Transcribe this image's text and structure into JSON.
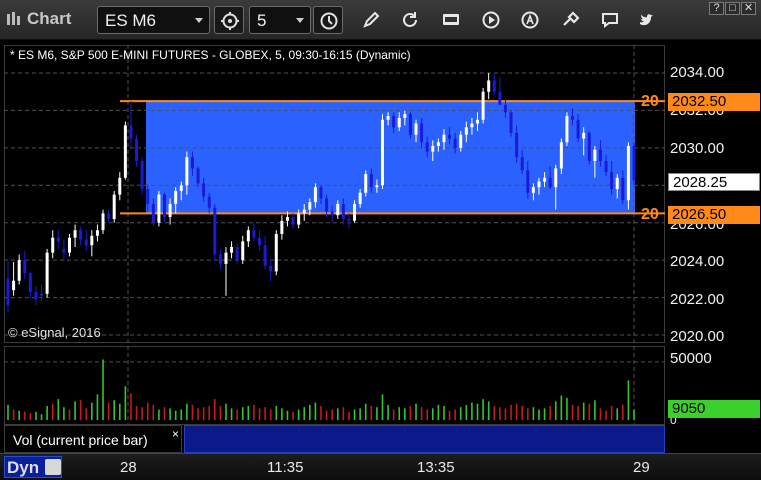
{
  "window": {
    "title": "Chart"
  },
  "toolbar": {
    "symbol_value": "ES M6",
    "interval_value": "5",
    "icons": [
      "chart-window-icon",
      "link-icon",
      "clock-icon",
      "draw-icon",
      "refresh-icon",
      "get-icon",
      "play-icon",
      "alert-icon",
      "tools-icon",
      "chat-icon",
      "twitter-icon"
    ],
    "window_buttons": [
      "?",
      "□",
      "✕"
    ]
  },
  "chart": {
    "description": "* ES M6, S&P 500 E-MINI FUTURES - GLOBEX, 5, 09:30-16:15 (Dynamic)",
    "copyright": "© eSignal, 2016",
    "colors": {
      "up": "#ffffff",
      "down": "#1a1ad8",
      "range_fill": "#2b62ff",
      "range_line": "#ff8a1a",
      "grid": "#3a3a3a",
      "volume_up": "#2fc92f",
      "volume_down": "#c81a1a"
    },
    "price_ticks": [
      "2034.00",
      "2032.00",
      "2030.00",
      "2028.00",
      "2026.00",
      "2024.00",
      "2022.00",
      "2020.00"
    ],
    "range_top": {
      "value": "2032.50",
      "label": "20"
    },
    "range_bottom": {
      "value": "2026.50",
      "label": "20"
    },
    "last_price": "2028.25",
    "volume": {
      "tick": "50000",
      "zero_tick": "0",
      "last": "9050",
      "label": "Vol (current price bar)",
      "close": "×"
    },
    "time_axis": {
      "mode": "Dyn",
      "labels": [
        "28",
        "11:35",
        "13:35",
        "29"
      ]
    }
  },
  "chart_data": {
    "type": "candlestick",
    "title": "ES M6, S&P 500 E-MINI FUTURES - GLOBEX, 5, 09:30-16:15 (Dynamic)",
    "ylim": [
      2020,
      2035
    ],
    "y_ticks": [
      2020,
      2022,
      2024,
      2026,
      2028,
      2030,
      2032,
      2034
    ],
    "x_tick_labels": [
      "28",
      "11:35",
      "13:35",
      "29"
    ],
    "price_zone": {
      "top": 2032.5,
      "bottom": 2026.5
    },
    "last_price": 2028.25,
    "volume_last": 9050,
    "volume_ylim": [
      0,
      55000
    ],
    "candles": [
      [
        2023.0,
        2023.9,
        2021.2,
        2021.6
      ],
      [
        2022.4,
        2023.9,
        2022.1,
        2022.9
      ],
      [
        2022.9,
        2024.3,
        2022.7,
        2024.0
      ],
      [
        2024.0,
        2024.5,
        2023.0,
        2023.3
      ],
      [
        2023.3,
        2023.4,
        2022.0,
        2022.3
      ],
      [
        2022.3,
        2022.6,
        2021.6,
        2021.9
      ],
      [
        2022.2,
        2022.7,
        2021.8,
        2022.1
      ],
      [
        2022.2,
        2024.6,
        2022.0,
        2024.4
      ],
      [
        2024.4,
        2025.6,
        2024.1,
        2025.2
      ],
      [
        2025.2,
        2025.6,
        2024.6,
        2025.0
      ],
      [
        2024.6,
        2025.1,
        2024.0,
        2024.4
      ],
      [
        2024.4,
        2025.4,
        2024.2,
        2025.2
      ],
      [
        2025.2,
        2025.9,
        2024.7,
        2025.6
      ],
      [
        2025.6,
        2025.8,
        2024.8,
        2025.1
      ],
      [
        2025.1,
        2025.6,
        2024.5,
        2024.8
      ],
      [
        2024.8,
        2025.6,
        2024.2,
        2025.3
      ],
      [
        2025.3,
        2025.9,
        2025.0,
        2025.6
      ],
      [
        2025.6,
        2026.7,
        2025.4,
        2026.5
      ],
      [
        2026.5,
        2026.7,
        2026.0,
        2026.2
      ],
      [
        2026.2,
        2027.7,
        2026.0,
        2027.5
      ],
      [
        2027.5,
        2028.7,
        2027.2,
        2028.4
      ],
      [
        2028.4,
        2031.4,
        2028.3,
        2031.2
      ],
      [
        2031.2,
        2032.5,
        2030.0,
        2030.5
      ],
      [
        2030.5,
        2030.7,
        2029.0,
        2029.3
      ],
      [
        2029.3,
        2029.5,
        2027.5,
        2027.8
      ],
      [
        2027.8,
        2028.0,
        2026.6,
        2027.0
      ],
      [
        2027.0,
        2027.3,
        2025.8,
        2026.0
      ],
      [
        2026.0,
        2027.7,
        2025.8,
        2027.5
      ],
      [
        2027.5,
        2027.6,
        2026.0,
        2026.3
      ],
      [
        2026.3,
        2027.3,
        2025.9,
        2027.0
      ],
      [
        2027.0,
        2027.9,
        2026.5,
        2027.7
      ],
      [
        2027.7,
        2028.2,
        2027.2,
        2028.0
      ],
      [
        2028.0,
        2029.8,
        2027.5,
        2029.5
      ],
      [
        2029.5,
        2029.8,
        2028.5,
        2028.9
      ],
      [
        2028.9,
        2029.0,
        2027.9,
        2028.1
      ],
      [
        2028.1,
        2028.4,
        2027.1,
        2027.4
      ],
      [
        2027.4,
        2027.6,
        2026.5,
        2026.8
      ],
      [
        2026.8,
        2027.0,
        2024.0,
        2024.3
      ],
      [
        2024.3,
        2024.6,
        2023.5,
        2023.8
      ],
      [
        2023.8,
        2024.7,
        2022.1,
        2024.4
      ],
      [
        2024.4,
        2025.0,
        2024.1,
        2024.7
      ],
      [
        2024.7,
        2024.9,
        2023.8,
        2024.0
      ],
      [
        2024.0,
        2025.3,
        2023.8,
        2025.0
      ],
      [
        2025.0,
        2025.8,
        2024.7,
        2025.6
      ],
      [
        2025.6,
        2026.0,
        2025.0,
        2025.2
      ],
      [
        2025.2,
        2025.6,
        2024.5,
        2024.8
      ],
      [
        2024.8,
        2025.3,
        2023.5,
        2023.7
      ],
      [
        2023.7,
        2024.0,
        2022.9,
        2023.4
      ],
      [
        2023.4,
        2025.6,
        2023.2,
        2025.4
      ],
      [
        2025.4,
        2026.4,
        2025.1,
        2026.1
      ],
      [
        2026.1,
        2026.6,
        2025.8,
        2026.3
      ],
      [
        2026.3,
        2026.5,
        2025.7,
        2025.9
      ],
      [
        2025.9,
        2026.7,
        2025.7,
        2026.5
      ],
      [
        2026.5,
        2027.0,
        2026.1,
        2026.7
      ],
      [
        2026.7,
        2027.3,
        2026.4,
        2027.1
      ],
      [
        2027.1,
        2028.1,
        2026.8,
        2027.9
      ],
      [
        2027.9,
        2028.0,
        2027.0,
        2027.3
      ],
      [
        2027.3,
        2027.5,
        2026.3,
        2026.6
      ],
      [
        2026.6,
        2026.9,
        2026.0,
        2026.4
      ],
      [
        2026.4,
        2027.2,
        2026.2,
        2027.0
      ],
      [
        2027.0,
        2027.3,
        2025.9,
        2026.2
      ],
      [
        2026.2,
        2026.5,
        2025.7,
        2026.1
      ],
      [
        2026.1,
        2027.2,
        2026.0,
        2027.0
      ],
      [
        2027.0,
        2027.8,
        2026.8,
        2027.6
      ],
      [
        2027.6,
        2028.8,
        2027.4,
        2028.6
      ],
      [
        2028.6,
        2028.9,
        2027.6,
        2027.9
      ],
      [
        2027.9,
        2028.3,
        2027.6,
        2028.0
      ],
      [
        2028.0,
        2031.8,
        2027.8,
        2031.5
      ],
      [
        2031.5,
        2031.9,
        2031.2,
        2031.7
      ],
      [
        2031.7,
        2031.9,
        2030.8,
        2031.1
      ],
      [
        2031.1,
        2031.9,
        2030.9,
        2031.6
      ],
      [
        2031.6,
        2032.0,
        2031.2,
        2031.8
      ],
      [
        2031.8,
        2031.9,
        2030.5,
        2030.7
      ],
      [
        2030.7,
        2031.5,
        2030.3,
        2031.3
      ],
      [
        2031.3,
        2031.6,
        2030.0,
        2030.3
      ],
      [
        2030.3,
        2030.6,
        2029.5,
        2029.8
      ],
      [
        2029.8,
        2030.4,
        2029.3,
        2030.1
      ],
      [
        2030.1,
        2030.5,
        2029.8,
        2030.3
      ],
      [
        2030.3,
        2031.0,
        2029.9,
        2030.7
      ],
      [
        2030.7,
        2031.1,
        2030.2,
        2030.5
      ],
      [
        2030.5,
        2030.8,
        2029.7,
        2030.0
      ],
      [
        2030.0,
        2030.9,
        2029.8,
        2030.7
      ],
      [
        2030.7,
        2031.4,
        2030.3,
        2031.1
      ],
      [
        2031.1,
        2031.6,
        2030.7,
        2031.3
      ],
      [
        2031.3,
        2031.9,
        2030.9,
        2031.5
      ],
      [
        2031.5,
        2033.2,
        2031.3,
        2033.0
      ],
      [
        2033.0,
        2034.0,
        2032.6,
        2033.6
      ],
      [
        2033.6,
        2034.0,
        2032.8,
        2033.0
      ],
      [
        2033.0,
        2033.8,
        2032.6,
        2032.3
      ],
      [
        2032.3,
        2032.6,
        2031.6,
        2031.9
      ],
      [
        2031.9,
        2032.0,
        2030.6,
        2030.8
      ],
      [
        2030.8,
        2031.2,
        2029.2,
        2029.5
      ],
      [
        2029.5,
        2029.9,
        2028.6,
        2028.8
      ],
      [
        2028.8,
        2029.3,
        2027.3,
        2027.6
      ],
      [
        2027.6,
        2028.1,
        2027.2,
        2027.9
      ],
      [
        2027.9,
        2028.4,
        2027.5,
        2028.2
      ],
      [
        2028.2,
        2028.7,
        2027.9,
        2028.4
      ],
      [
        2028.4,
        2029.0,
        2027.8,
        2027.9
      ],
      [
        2027.9,
        2029.1,
        2026.7,
        2028.9
      ],
      [
        2028.9,
        2030.5,
        2028.6,
        2030.3
      ],
      [
        2030.3,
        2031.9,
        2030.1,
        2031.7
      ],
      [
        2031.7,
        2032.1,
        2031.2,
        2031.5
      ],
      [
        2031.5,
        2031.8,
        2030.3,
        2030.5
      ],
      [
        2030.5,
        2031.1,
        2029.6,
        2030.8
      ],
      [
        2030.8,
        2030.9,
        2029.1,
        2029.3
      ],
      [
        2029.3,
        2030.1,
        2028.4,
        2029.9
      ],
      [
        2029.9,
        2030.4,
        2029.0,
        2029.3
      ],
      [
        2029.3,
        2029.6,
        2028.5,
        2028.7
      ],
      [
        2028.7,
        2029.3,
        2027.5,
        2027.8
      ],
      [
        2027.8,
        2028.6,
        2027.3,
        2028.4
      ],
      [
        2028.4,
        2028.8,
        2027.0,
        2027.2
      ],
      [
        2027.2,
        2030.3,
        2026.7,
        2030.1
      ],
      [
        2030.1,
        2030.3,
        2028.0,
        2028.25
      ]
    ],
    "volumes": [
      [
        13000,
        1
      ],
      [
        9000,
        0
      ],
      [
        8000,
        1
      ],
      [
        7000,
        0
      ],
      [
        6000,
        0
      ],
      [
        7000,
        1
      ],
      [
        5000,
        1
      ],
      [
        12000,
        1
      ],
      [
        14000,
        0
      ],
      [
        18000,
        1
      ],
      [
        11000,
        1
      ],
      [
        9000,
        0
      ],
      [
        16000,
        1
      ],
      [
        17000,
        0
      ],
      [
        10000,
        0
      ],
      [
        15000,
        1
      ],
      [
        22000,
        1
      ],
      [
        52000,
        1
      ],
      [
        15000,
        0
      ],
      [
        17000,
        1
      ],
      [
        14000,
        1
      ],
      [
        29000,
        1
      ],
      [
        23000,
        0
      ],
      [
        12000,
        0
      ],
      [
        11000,
        0
      ],
      [
        15000,
        0
      ],
      [
        13000,
        0
      ],
      [
        9000,
        1
      ],
      [
        11000,
        0
      ],
      [
        10000,
        1
      ],
      [
        8000,
        1
      ],
      [
        9000,
        1
      ],
      [
        14000,
        1
      ],
      [
        13000,
        0
      ],
      [
        10000,
        0
      ],
      [
        11000,
        0
      ],
      [
        12000,
        0
      ],
      [
        18000,
        0
      ],
      [
        12000,
        0
      ],
      [
        14000,
        1
      ],
      [
        10000,
        1
      ],
      [
        9000,
        0
      ],
      [
        11000,
        1
      ],
      [
        12000,
        1
      ],
      [
        13000,
        0
      ],
      [
        10000,
        0
      ],
      [
        11000,
        0
      ],
      [
        9000,
        0
      ],
      [
        12000,
        1
      ],
      [
        10000,
        1
      ],
      [
        8000,
        1
      ],
      [
        7000,
        0
      ],
      [
        9000,
        1
      ],
      [
        11000,
        1
      ],
      [
        13000,
        1
      ],
      [
        15000,
        1
      ],
      [
        12000,
        0
      ],
      [
        8000,
        0
      ],
      [
        9000,
        0
      ],
      [
        10000,
        1
      ],
      [
        11000,
        0
      ],
      [
        7000,
        0
      ],
      [
        9000,
        1
      ],
      [
        10000,
        1
      ],
      [
        14000,
        1
      ],
      [
        12000,
        0
      ],
      [
        11000,
        1
      ],
      [
        22000,
        1
      ],
      [
        13000,
        1
      ],
      [
        9000,
        0
      ],
      [
        11000,
        1
      ],
      [
        10000,
        1
      ],
      [
        12000,
        0
      ],
      [
        14000,
        1
      ],
      [
        11000,
        0
      ],
      [
        9000,
        0
      ],
      [
        10000,
        1
      ],
      [
        13000,
        1
      ],
      [
        12000,
        1
      ],
      [
        8000,
        0
      ],
      [
        9000,
        0
      ],
      [
        11000,
        1
      ],
      [
        13000,
        1
      ],
      [
        15000,
        1
      ],
      [
        14000,
        1
      ],
      [
        18000,
        1
      ],
      [
        16000,
        1
      ],
      [
        12000,
        0
      ],
      [
        11000,
        0
      ],
      [
        10000,
        0
      ],
      [
        13000,
        0
      ],
      [
        14000,
        0
      ],
      [
        12000,
        0
      ],
      [
        10000,
        0
      ],
      [
        11000,
        1
      ],
      [
        9000,
        1
      ],
      [
        10000,
        1
      ],
      [
        12000,
        0
      ],
      [
        16000,
        1
      ],
      [
        21000,
        1
      ],
      [
        19000,
        1
      ],
      [
        13000,
        0
      ],
      [
        12000,
        0
      ],
      [
        15000,
        1
      ],
      [
        14000,
        0
      ],
      [
        17000,
        1
      ],
      [
        10000,
        0
      ],
      [
        8000,
        0
      ],
      [
        12000,
        0
      ],
      [
        10000,
        1
      ],
      [
        13000,
        0
      ],
      [
        34000,
        1
      ],
      [
        9050,
        1
      ]
    ]
  }
}
